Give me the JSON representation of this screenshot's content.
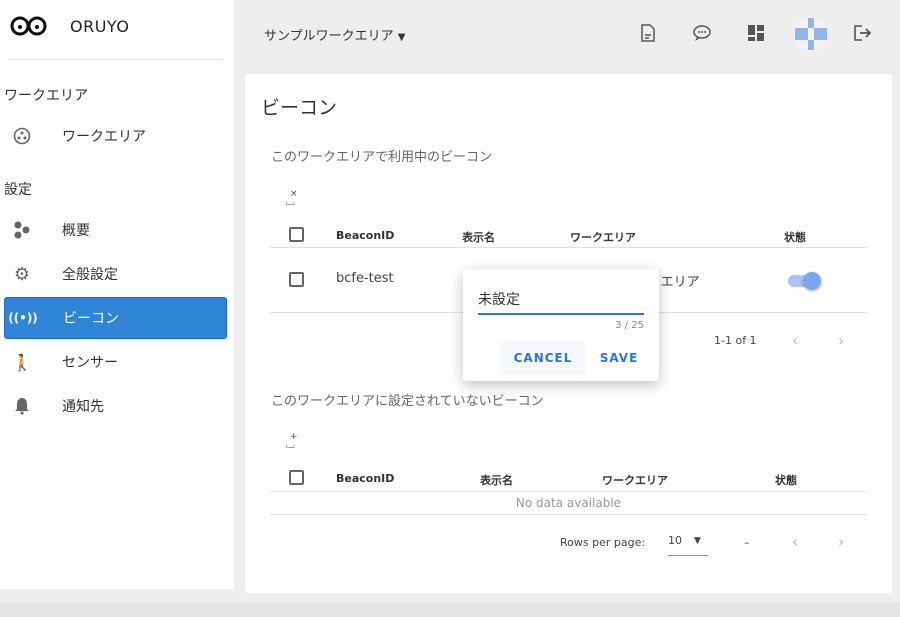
{
  "app": {
    "name": "ORUYO"
  },
  "sidebar": {
    "section_workarea": "ワークエリア",
    "section_settings": "設定",
    "items": [
      {
        "label": "ワークエリア",
        "icon": "workarea-icon"
      },
      {
        "label": "概要",
        "icon": "overview-icon"
      },
      {
        "label": "全般設定",
        "icon": "gear-icon"
      },
      {
        "label": "ビーコン",
        "icon": "beacon-icon",
        "active": true
      },
      {
        "label": "センサー",
        "icon": "sensor-icon"
      },
      {
        "label": "通知先",
        "icon": "bell-icon"
      }
    ]
  },
  "topbar": {
    "workspace": "サンプルワークエリア",
    "icons": [
      "document-icon",
      "chat-icon",
      "dashboard-icon",
      "avatar",
      "logout-icon"
    ],
    "accent": "#2f84d6"
  },
  "page": {
    "title": "ビーコン",
    "used": {
      "subtitle": "このワークエリアで利用中のビーコン",
      "columns": [
        "BeaconID",
        "表示名",
        "ワークエリア",
        "状態"
      ],
      "rows": [
        {
          "beacon_id": "bcfe-test",
          "display_name": "",
          "workarea": "サンプルワークエリア",
          "enabled": true
        }
      ],
      "range": "1-1 of 1"
    },
    "unused": {
      "subtitle": "このワークエリアに設定されていないビーコン",
      "columns": [
        "BeaconID",
        "表示名",
        "ワークエリア",
        "状態"
      ],
      "empty": "No data available",
      "rows_per_page_label": "Rows per page:",
      "rows_per_page": "10",
      "range": "–"
    }
  },
  "dialog": {
    "value": "未設定",
    "counter": "3 / 25",
    "cancel": "CANCEL",
    "save": "SAVE"
  }
}
